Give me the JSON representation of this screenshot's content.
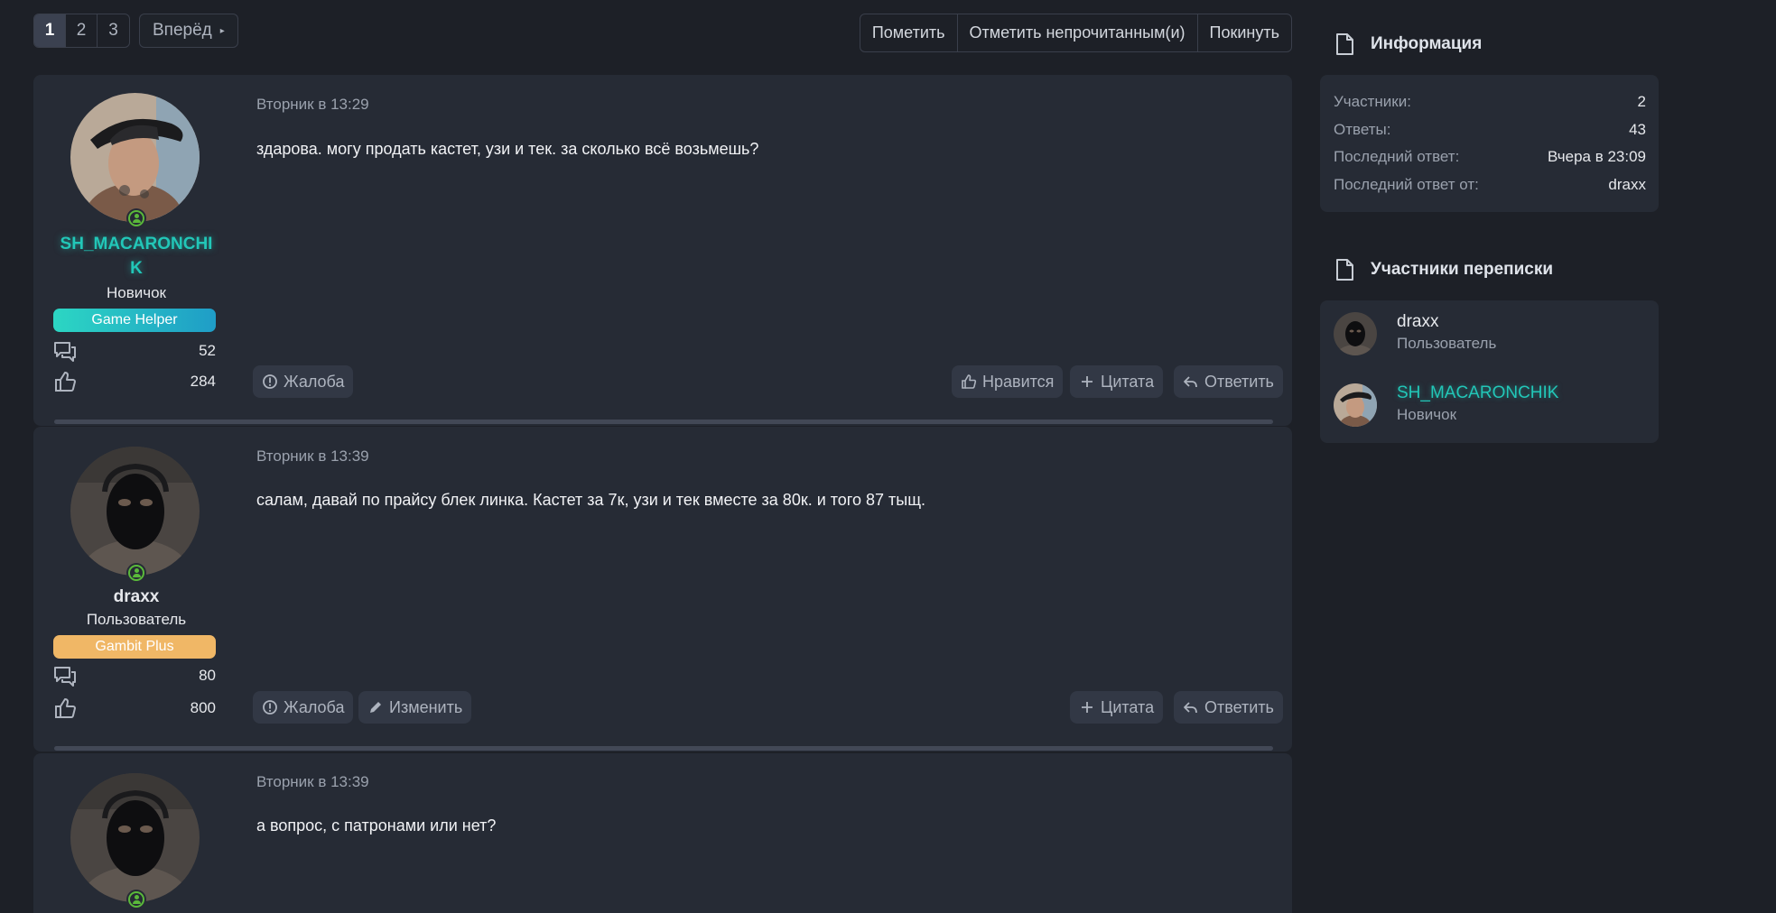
{
  "pagination": {
    "pages": [
      "1",
      "2",
      "3"
    ],
    "next_label": "Вперёд"
  },
  "thread_actions": [
    "Пометить",
    "Отметить непрочитанным(и)",
    "Покинуть"
  ],
  "posts": [
    {
      "username": "SH_MACARONCHIK",
      "username_line1": "SH_MACARONCHI",
      "username_line2": "K",
      "rank": "Новичок",
      "badge": "Game Helper",
      "messages": "52",
      "reactions": "284",
      "time": "Вторник в 13:29",
      "text": "здарова. могу продать кастет, узи и тек. за сколько всё возьмешь?",
      "buttons": {
        "report": "Жалоба",
        "like": "Нравится",
        "quote": "Цитата",
        "reply": "Ответить"
      }
    },
    {
      "username": "draxx",
      "rank": "Пользователь",
      "badge": "Gambit Plus",
      "messages": "80",
      "reactions": "800",
      "time": "Вторник в 13:39",
      "text": "салам, давай по прайсу блек линка. Кастет за 7к, узи и тек вместе за 80к. и того 87 тыщ.",
      "buttons": {
        "report": "Жалоба",
        "edit": "Изменить",
        "quote": "Цитата",
        "reply": "Ответить"
      }
    },
    {
      "username": "draxx",
      "time": "Вторник в 13:39",
      "text": "а вопрос, с патронами или нет?"
    }
  ],
  "sidebar": {
    "info": {
      "title": "Информация",
      "rows": [
        {
          "label": "Участники:",
          "value": "2"
        },
        {
          "label": "Ответы:",
          "value": "43"
        },
        {
          "label": "Последний ответ:",
          "value": "Вчера в 23:09"
        },
        {
          "label": "Последний ответ от:",
          "value": "draxx"
        }
      ]
    },
    "participants": {
      "title": "Участники переписки",
      "members": [
        {
          "name": "draxx",
          "role": "Пользователь"
        },
        {
          "name": "SH_MACARONCHIK",
          "role": "Новичок"
        }
      ]
    }
  },
  "colors": {
    "background": "#1d2027",
    "panel": "#262b35",
    "accent_teal": "#22c7b8",
    "badge_gold": "#f0b766",
    "online_green": "#5ab93a"
  },
  "icons": [
    "file-icon",
    "online-status-icon",
    "messages-icon",
    "thumbs-up-icon",
    "alert-icon",
    "pencil-icon",
    "plus-icon",
    "reply-icon",
    "caret-right-icon"
  ]
}
